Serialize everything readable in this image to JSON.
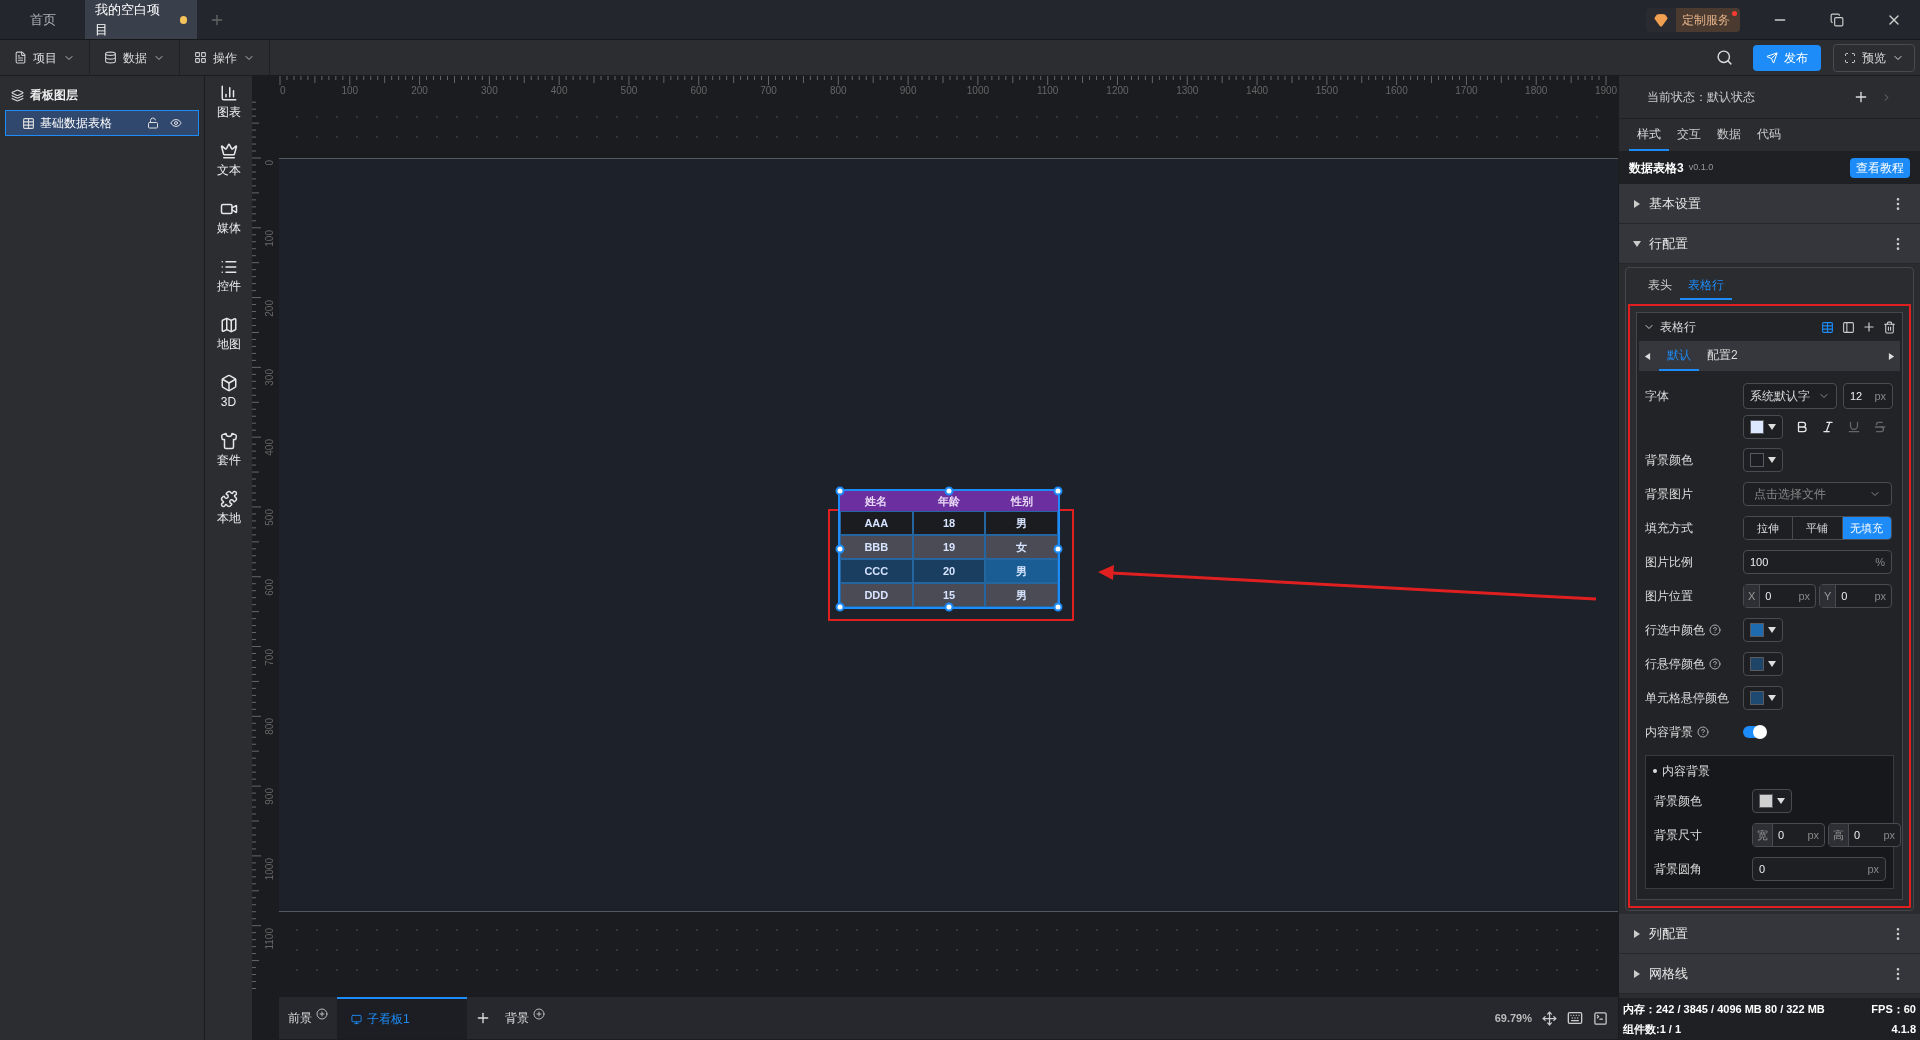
{
  "tabs": [
    {
      "label": "首页",
      "selected": false,
      "unsaved": false
    },
    {
      "label": "我的空白项目",
      "selected": true,
      "unsaved": true
    }
  ],
  "custom_service": {
    "label": "定制服务",
    "notification": true
  },
  "menus": [
    {
      "label": "项目"
    },
    {
      "label": "数据"
    },
    {
      "label": "操作"
    }
  ],
  "publish_button": "发布",
  "preview_button": "预览",
  "layers": {
    "title": "看板图层",
    "items": [
      {
        "label": "基础数据表格",
        "selected": true
      }
    ]
  },
  "tools": [
    {
      "label": "图表"
    },
    {
      "label": "文本"
    },
    {
      "label": "媒体"
    },
    {
      "label": "控件"
    },
    {
      "label": "地图"
    },
    {
      "label": "3D"
    },
    {
      "label": "套件"
    },
    {
      "label": "本地"
    }
  ],
  "ruler": {
    "x_labels": [
      "0",
      "100",
      "200",
      "300",
      "400",
      "500",
      "600",
      "700",
      "800",
      "900",
      "1000",
      "1100",
      "1200",
      "1300",
      "1400",
      "1500",
      "1600",
      "1700",
      "1800",
      "1900"
    ],
    "y_labels": [
      "0",
      "100",
      "200",
      "300",
      "400",
      "500",
      "600",
      "700",
      "800",
      "900",
      "1000",
      "1100"
    ]
  },
  "table": {
    "columns": [
      "姓名",
      "年龄",
      "性别"
    ],
    "rows": [
      {
        "kind": "default",
        "hovered": false,
        "cells": [
          {
            "text": "AAA",
            "hovered": false
          },
          {
            "text": "18",
            "hovered": false
          },
          {
            "text": "男",
            "hovered": false
          }
        ]
      },
      {
        "kind": "alternate",
        "hovered": false,
        "cells": [
          {
            "text": "BBB",
            "hovered": false
          },
          {
            "text": "19",
            "hovered": false
          },
          {
            "text": "女",
            "hovered": false
          }
        ]
      },
      {
        "kind": "default",
        "hovered": true,
        "cells": [
          {
            "text": "CCC",
            "hovered": false
          },
          {
            "text": "20",
            "hovered": false
          },
          {
            "text": "男",
            "hovered": true
          }
        ]
      },
      {
        "kind": "alternate",
        "hovered": false,
        "cells": [
          {
            "text": "DDD",
            "hovered": false
          },
          {
            "text": "15",
            "hovered": false
          },
          {
            "text": "男",
            "hovered": false
          }
        ]
      }
    ]
  },
  "bottom_bar": {
    "foreground": "前景",
    "boards": [
      {
        "label": "子看板1",
        "selected": true
      }
    ],
    "background": "背景",
    "zoom": "69.79%"
  },
  "inspector": {
    "state_label": "当前状态：默认状态",
    "tabs": [
      {
        "label": "样式",
        "selected": true
      },
      {
        "label": "交互",
        "selected": false
      },
      {
        "label": "数据",
        "selected": false
      },
      {
        "label": "代码",
        "selected": false
      }
    ],
    "component_name": "数据表格3",
    "version": "v0.1.0",
    "tutorial_button": "查看教程",
    "sections_top": [
      {
        "label": "基本设置",
        "expanded": false
      },
      {
        "label": "行配置",
        "expanded": true
      }
    ],
    "row_config": {
      "tabs": [
        {
          "label": "表头",
          "selected": false
        },
        {
          "label": "表格行",
          "selected": true
        }
      ],
      "group": {
        "title": "表格行",
        "expanded": true,
        "configs": [
          {
            "label": "默认",
            "selected": true
          },
          {
            "label": "配置2",
            "selected": false
          }
        ],
        "fields": [
          {
            "kind": "font",
            "label": "字体",
            "font": "系统默认字",
            "size": "12",
            "unit": "px",
            "color": "#dce8ff",
            "styles": [
              {
                "kind": "bold",
                "disabled": false
              },
              {
                "kind": "italic",
                "disabled": false
              },
              {
                "kind": "underline",
                "disabled": true
              },
              {
                "kind": "strike",
                "disabled": true
              }
            ]
          },
          {
            "kind": "color",
            "label": "背景颜色",
            "color": "#1c1d22"
          },
          {
            "kind": "file",
            "label": "背景图片",
            "placeholder": "点击选择文件"
          },
          {
            "kind": "segmented",
            "label": "填充方式",
            "options": [
              {
                "label": "拉伸",
                "selected": false
              },
              {
                "label": "平铺",
                "selected": false
              },
              {
                "label": "无填充",
                "selected": true
              }
            ]
          },
          {
            "kind": "number",
            "label": "图片比例",
            "value": "100",
            "unit": "%"
          },
          {
            "kind": "pair",
            "label": "图片位置",
            "parts": [
              {
                "prefix": "X",
                "value": "0",
                "unit": "px"
              },
              {
                "prefix": "Y",
                "value": "0",
                "unit": "px"
              }
            ]
          },
          {
            "kind": "color",
            "label": "行选中颜色",
            "help": true,
            "color": "#1e6bb0"
          },
          {
            "kind": "color",
            "label": "行悬停颜色",
            "help": true,
            "color": "#1e4468"
          },
          {
            "kind": "color",
            "label": "单元格悬停颜色",
            "color": "#1e4a72"
          },
          {
            "kind": "switch",
            "label": "内容背景",
            "help": true,
            "on": true
          },
          {
            "kind": "group",
            "title": "内容背景",
            "fields": [
              {
                "kind": "color",
                "label": "背景颜色",
                "color": "#d0d0d0"
              },
              {
                "kind": "pair",
                "label": "背景尺寸",
                "parts": [
                  {
                    "prefix": "宽",
                    "value": "0",
                    "unit": "px"
                  },
                  {
                    "prefix": "高",
                    "value": "0",
                    "unit": "px"
                  }
                ]
              },
              {
                "kind": "number",
                "label": "背景圆角",
                "value": "0",
                "unit": "px"
              }
            ]
          }
        ]
      }
    },
    "sections_bottom": [
      {
        "label": "列配置",
        "expanded": false
      },
      {
        "label": "网格线",
        "expanded": false
      }
    ],
    "status": {
      "memory": "内存：242 / 3845 / 4096 MB  80 / 322 MB",
      "fps": "FPS：60",
      "components": "组件数:1 / 1",
      "version": "4.1.8"
    }
  }
}
